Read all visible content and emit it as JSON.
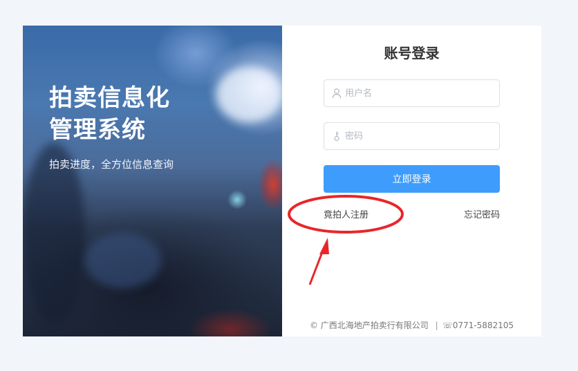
{
  "hero": {
    "title_line1": "拍卖信息化",
    "title_line2": "管理系统",
    "subtitle": "拍卖进度，全方位信息查询"
  },
  "login": {
    "title": "账号登录",
    "username_placeholder": "用户名",
    "password_placeholder": "密码",
    "submit_label": "立即登录",
    "register_label": "竟拍人注册",
    "forgot_label": "忘记密码"
  },
  "footer": {
    "company": "广西北海地产拍卖行有限公司",
    "phone": "0771-5882105",
    "copyright_symbol": "©",
    "separator": "|",
    "phone_icon": "☏"
  },
  "icons": {
    "username": "user-icon",
    "password": "key-icon"
  },
  "colors": {
    "accent": "#3e9dfc",
    "annotation": "#e8262a"
  }
}
